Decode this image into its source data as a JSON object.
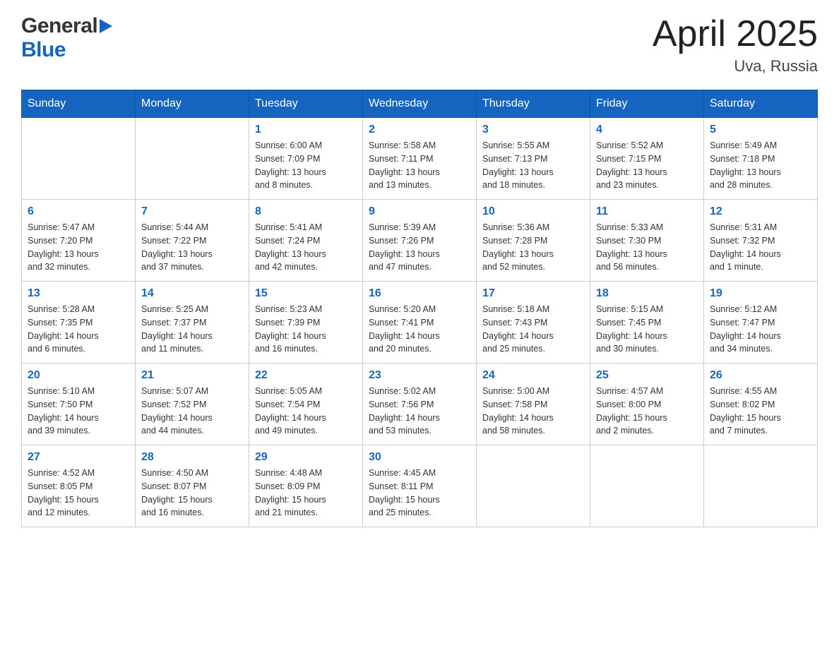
{
  "header": {
    "logo_general": "General",
    "logo_blue": "Blue",
    "month": "April 2025",
    "location": "Uva, Russia"
  },
  "days_of_week": [
    "Sunday",
    "Monday",
    "Tuesday",
    "Wednesday",
    "Thursday",
    "Friday",
    "Saturday"
  ],
  "weeks": [
    [
      {
        "day": "",
        "info": ""
      },
      {
        "day": "",
        "info": ""
      },
      {
        "day": "1",
        "info": "Sunrise: 6:00 AM\nSunset: 7:09 PM\nDaylight: 13 hours\nand 8 minutes."
      },
      {
        "day": "2",
        "info": "Sunrise: 5:58 AM\nSunset: 7:11 PM\nDaylight: 13 hours\nand 13 minutes."
      },
      {
        "day": "3",
        "info": "Sunrise: 5:55 AM\nSunset: 7:13 PM\nDaylight: 13 hours\nand 18 minutes."
      },
      {
        "day": "4",
        "info": "Sunrise: 5:52 AM\nSunset: 7:15 PM\nDaylight: 13 hours\nand 23 minutes."
      },
      {
        "day": "5",
        "info": "Sunrise: 5:49 AM\nSunset: 7:18 PM\nDaylight: 13 hours\nand 28 minutes."
      }
    ],
    [
      {
        "day": "6",
        "info": "Sunrise: 5:47 AM\nSunset: 7:20 PM\nDaylight: 13 hours\nand 32 minutes."
      },
      {
        "day": "7",
        "info": "Sunrise: 5:44 AM\nSunset: 7:22 PM\nDaylight: 13 hours\nand 37 minutes."
      },
      {
        "day": "8",
        "info": "Sunrise: 5:41 AM\nSunset: 7:24 PM\nDaylight: 13 hours\nand 42 minutes."
      },
      {
        "day": "9",
        "info": "Sunrise: 5:39 AM\nSunset: 7:26 PM\nDaylight: 13 hours\nand 47 minutes."
      },
      {
        "day": "10",
        "info": "Sunrise: 5:36 AM\nSunset: 7:28 PM\nDaylight: 13 hours\nand 52 minutes."
      },
      {
        "day": "11",
        "info": "Sunrise: 5:33 AM\nSunset: 7:30 PM\nDaylight: 13 hours\nand 56 minutes."
      },
      {
        "day": "12",
        "info": "Sunrise: 5:31 AM\nSunset: 7:32 PM\nDaylight: 14 hours\nand 1 minute."
      }
    ],
    [
      {
        "day": "13",
        "info": "Sunrise: 5:28 AM\nSunset: 7:35 PM\nDaylight: 14 hours\nand 6 minutes."
      },
      {
        "day": "14",
        "info": "Sunrise: 5:25 AM\nSunset: 7:37 PM\nDaylight: 14 hours\nand 11 minutes."
      },
      {
        "day": "15",
        "info": "Sunrise: 5:23 AM\nSunset: 7:39 PM\nDaylight: 14 hours\nand 16 minutes."
      },
      {
        "day": "16",
        "info": "Sunrise: 5:20 AM\nSunset: 7:41 PM\nDaylight: 14 hours\nand 20 minutes."
      },
      {
        "day": "17",
        "info": "Sunrise: 5:18 AM\nSunset: 7:43 PM\nDaylight: 14 hours\nand 25 minutes."
      },
      {
        "day": "18",
        "info": "Sunrise: 5:15 AM\nSunset: 7:45 PM\nDaylight: 14 hours\nand 30 minutes."
      },
      {
        "day": "19",
        "info": "Sunrise: 5:12 AM\nSunset: 7:47 PM\nDaylight: 14 hours\nand 34 minutes."
      }
    ],
    [
      {
        "day": "20",
        "info": "Sunrise: 5:10 AM\nSunset: 7:50 PM\nDaylight: 14 hours\nand 39 minutes."
      },
      {
        "day": "21",
        "info": "Sunrise: 5:07 AM\nSunset: 7:52 PM\nDaylight: 14 hours\nand 44 minutes."
      },
      {
        "day": "22",
        "info": "Sunrise: 5:05 AM\nSunset: 7:54 PM\nDaylight: 14 hours\nand 49 minutes."
      },
      {
        "day": "23",
        "info": "Sunrise: 5:02 AM\nSunset: 7:56 PM\nDaylight: 14 hours\nand 53 minutes."
      },
      {
        "day": "24",
        "info": "Sunrise: 5:00 AM\nSunset: 7:58 PM\nDaylight: 14 hours\nand 58 minutes."
      },
      {
        "day": "25",
        "info": "Sunrise: 4:57 AM\nSunset: 8:00 PM\nDaylight: 15 hours\nand 2 minutes."
      },
      {
        "day": "26",
        "info": "Sunrise: 4:55 AM\nSunset: 8:02 PM\nDaylight: 15 hours\nand 7 minutes."
      }
    ],
    [
      {
        "day": "27",
        "info": "Sunrise: 4:52 AM\nSunset: 8:05 PM\nDaylight: 15 hours\nand 12 minutes."
      },
      {
        "day": "28",
        "info": "Sunrise: 4:50 AM\nSunset: 8:07 PM\nDaylight: 15 hours\nand 16 minutes."
      },
      {
        "day": "29",
        "info": "Sunrise: 4:48 AM\nSunset: 8:09 PM\nDaylight: 15 hours\nand 21 minutes."
      },
      {
        "day": "30",
        "info": "Sunrise: 4:45 AM\nSunset: 8:11 PM\nDaylight: 15 hours\nand 25 minutes."
      },
      {
        "day": "",
        "info": ""
      },
      {
        "day": "",
        "info": ""
      },
      {
        "day": "",
        "info": ""
      }
    ]
  ]
}
